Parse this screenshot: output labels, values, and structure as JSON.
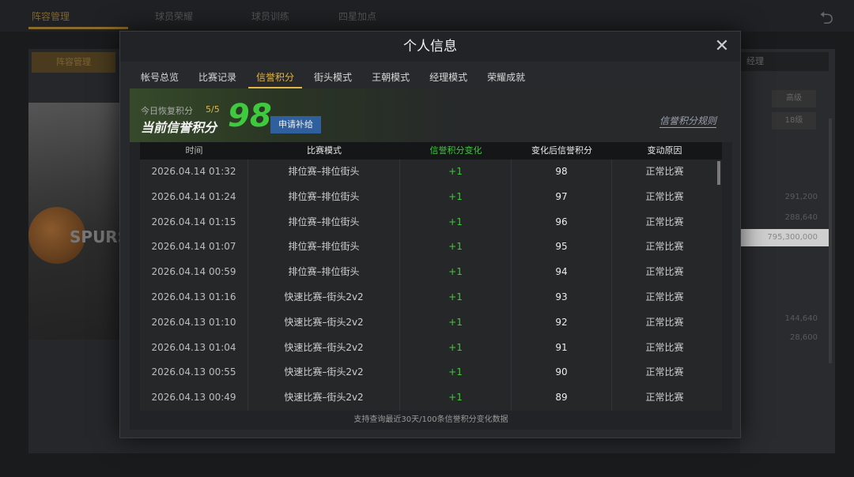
{
  "background": {
    "tabs": [
      "阵容管理",
      "球员荣耀",
      "球员训练",
      "四星加点"
    ],
    "left_tab": "阵容管理",
    "jersey_text": "SPURS",
    "right_dropdown": "经理",
    "right_buttons": [
      "高级",
      "18级"
    ],
    "right_numbers": [
      "291,200",
      "288,640",
      "144,640",
      "28,600"
    ],
    "right_highlight": "795,300,000"
  },
  "modal": {
    "title": "个人信息",
    "close_symbol": "✕",
    "tabs": [
      {
        "label": "帐号总览"
      },
      {
        "label": "比赛记录"
      },
      {
        "label": "信誉积分"
      },
      {
        "label": "街头模式"
      },
      {
        "label": "王朝模式"
      },
      {
        "label": "经理模式"
      },
      {
        "label": "荣耀成就"
      }
    ],
    "active_tab": "信誉积分"
  },
  "credit": {
    "today_label": "今日恢复积分",
    "today_value": "5/5",
    "current_label": "当前信誉积分",
    "score": "98",
    "apply_button": "申请补给",
    "rules_link": "信誉积分规则"
  },
  "table": {
    "headers": [
      "时间",
      "比赛模式",
      "信誉积分变化",
      "变化后信誉积分",
      "变动原因"
    ],
    "rows": [
      [
        "2026.04.14  01:32",
        "排位赛–排位街头",
        "+1",
        "98",
        "正常比赛"
      ],
      [
        "2026.04.14  01:24",
        "排位赛–排位街头",
        "+1",
        "97",
        "正常比赛"
      ],
      [
        "2026.04.14  01:15",
        "排位赛–排位街头",
        "+1",
        "96",
        "正常比赛"
      ],
      [
        "2026.04.14  01:07",
        "排位赛–排位街头",
        "+1",
        "95",
        "正常比赛"
      ],
      [
        "2026.04.14  00:59",
        "排位赛–排位街头",
        "+1",
        "94",
        "正常比赛"
      ],
      [
        "2026.04.13  01:16",
        "快速比赛–街头2v2",
        "+1",
        "93",
        "正常比赛"
      ],
      [
        "2026.04.13  01:10",
        "快速比赛–街头2v2",
        "+1",
        "92",
        "正常比赛"
      ],
      [
        "2026.04.13  01:04",
        "快速比赛–街头2v2",
        "+1",
        "91",
        "正常比赛"
      ],
      [
        "2026.04.13  00:55",
        "快速比赛–街头2v2",
        "+1",
        "90",
        "正常比赛"
      ],
      [
        "2026.04.13  00:49",
        "快速比赛–街头2v2",
        "+1",
        "89",
        "正常比赛"
      ]
    ],
    "footer_note": "支持查询最近30天/100条信誉积分变化数据"
  },
  "colors": {
    "accent": "#e2b648",
    "positive": "#3ec93e",
    "button": "#2f5f9c"
  }
}
